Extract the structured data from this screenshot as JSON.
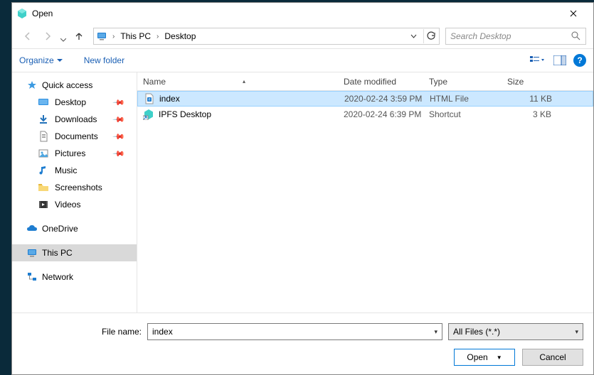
{
  "window": {
    "title": "Open"
  },
  "nav": {
    "breadcrumb": [
      "This PC",
      "Desktop"
    ],
    "search_placeholder": "Search Desktop"
  },
  "toolbar": {
    "organize": "Organize",
    "new_folder": "New folder"
  },
  "sidebar": {
    "quick_access": {
      "label": "Quick access"
    },
    "items": [
      {
        "label": "Desktop",
        "pinned": true
      },
      {
        "label": "Downloads",
        "pinned": true
      },
      {
        "label": "Documents",
        "pinned": true
      },
      {
        "label": "Pictures",
        "pinned": true
      },
      {
        "label": "Music",
        "pinned": false
      },
      {
        "label": "Screenshots",
        "pinned": false
      },
      {
        "label": "Videos",
        "pinned": false
      }
    ],
    "onedrive": {
      "label": "OneDrive"
    },
    "this_pc": {
      "label": "This PC"
    },
    "network": {
      "label": "Network"
    }
  },
  "columns": {
    "name": "Name",
    "date": "Date modified",
    "type": "Type",
    "size": "Size"
  },
  "files": [
    {
      "name": "index",
      "date": "2020-02-24 3:59 PM",
      "type": "HTML File",
      "size": "11 KB",
      "selected": true
    },
    {
      "name": "IPFS Desktop",
      "date": "2020-02-24 6:39 PM",
      "type": "Shortcut",
      "size": "3 KB",
      "selected": false
    }
  ],
  "footer": {
    "filename_label": "File name:",
    "filename_value": "index",
    "filter": "All Files (*.*)",
    "open": "Open",
    "cancel": "Cancel"
  }
}
